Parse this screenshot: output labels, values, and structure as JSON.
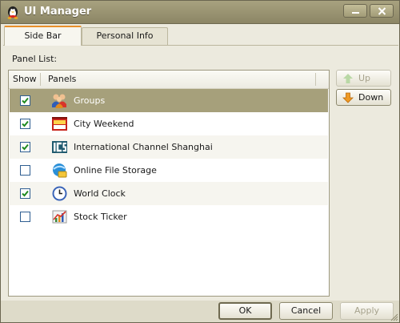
{
  "window": {
    "title": "UI Manager"
  },
  "tabs": [
    {
      "label": "Side Bar",
      "active": true
    },
    {
      "label": "Personal Info",
      "active": false
    }
  ],
  "panel_list_label": "Panel List:",
  "list": {
    "columns": {
      "show": "Show",
      "panels": "Panels"
    },
    "items": [
      {
        "label": "Groups",
        "checked": true,
        "icon": "groups-icon",
        "selected": true
      },
      {
        "label": "City Weekend",
        "checked": true,
        "icon": "city-weekend-icon"
      },
      {
        "label": "International Channel Shanghai",
        "checked": true,
        "icon": "ics-icon"
      },
      {
        "label": "Online File Storage",
        "checked": false,
        "icon": "file-storage-icon"
      },
      {
        "label": "World Clock",
        "checked": true,
        "icon": "clock-icon"
      },
      {
        "label": "Stock Ticker",
        "checked": false,
        "icon": "stock-ticker-icon"
      }
    ]
  },
  "side_buttons": {
    "up": "Up",
    "down": "Down"
  },
  "footer": {
    "ok": "OK",
    "cancel": "Cancel",
    "apply": "Apply"
  },
  "colors": {
    "titlebar": "#8c8665",
    "selected_row": "#a6a07b",
    "tab_accent": "#e88f2a"
  }
}
